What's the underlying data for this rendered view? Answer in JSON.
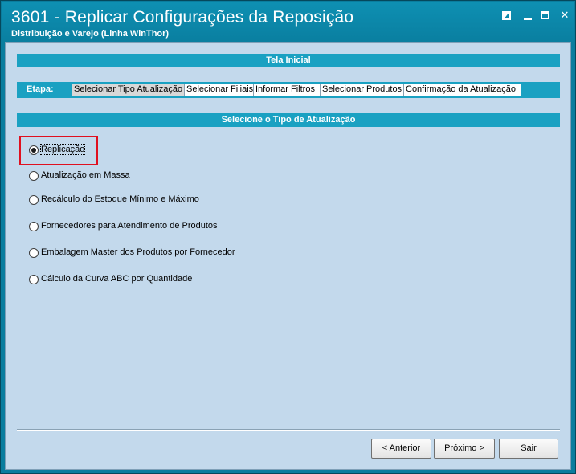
{
  "window": {
    "title": "3601 - Replicar Configurações da Reposição",
    "subtitle": "Distribuição e Varejo (Linha WinThor)",
    "controls": [
      "restore-icon",
      "minimize-icon",
      "maximize-icon",
      "close-icon"
    ],
    "close_glyph": "✕"
  },
  "header": {
    "section_title": "Tela Inicial"
  },
  "steps": {
    "label": "Etapa:",
    "items": [
      "Selecionar Tipo Atualização",
      "Selecionar Filiais",
      "Informar Filtros",
      "Selecionar Produtos",
      "Confirmação da Atualização"
    ],
    "active_index": 0
  },
  "options_section": {
    "title": "Selecione o Tipo de Atualização",
    "options": [
      {
        "label": "Replicação",
        "selected": true
      },
      {
        "label": "Atualização em Massa",
        "selected": false
      },
      {
        "label": "Recálculo do Estoque Mínimo e Máximo",
        "selected": false
      },
      {
        "label": "Fornecedores para Atendimento de Produtos",
        "selected": false
      },
      {
        "label": "Embalagem Master dos Produtos por Fornecedor",
        "selected": false
      },
      {
        "label": "Cálculo da Curva ABC por Quantidade",
        "selected": false
      }
    ]
  },
  "footer": {
    "previous_label": "< Anterior",
    "next_label": "Próximo >",
    "exit_label": "Sair"
  },
  "colors": {
    "titlebar": "#0a7fa0",
    "section_bar": "#1aa1c2",
    "client_bg": "#c3d9ec",
    "highlight": "#e0101f"
  }
}
